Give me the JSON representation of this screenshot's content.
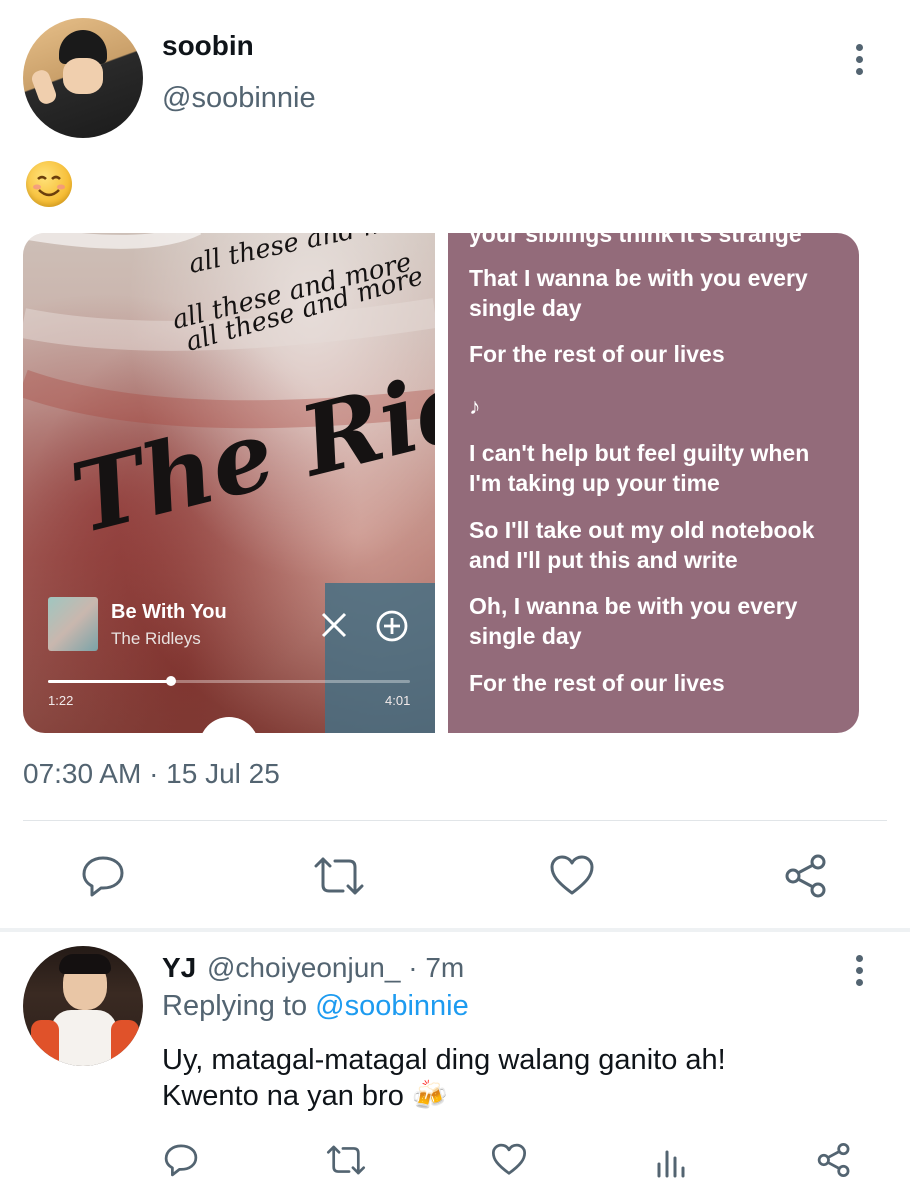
{
  "tweet": {
    "author_name": "soobin",
    "author_handle": "@soobinnie",
    "body_emoji": "😊",
    "timestamp": "07:30 AM · 15 Jul 25"
  },
  "music_card": {
    "album_text_lines": [
      "all these and more",
      "all these and more",
      "all these and more"
    ],
    "album_band": "The Ridleys",
    "song_title": "Be With You",
    "song_artist": "The Ridleys",
    "elapsed": "1:22",
    "duration": "4:01",
    "progress": 0.34
  },
  "lyrics": {
    "cut_line": "your siblings think it's strange",
    "lines": [
      "That I wanna be with you every single day",
      "For the rest of our lives",
      "♪",
      "I can't help but feel guilty when I'm taking up your time",
      "So I'll take out my old notebook and I'll put this and write",
      "Oh, I wanna be with you every single day",
      "For the rest of our lives"
    ]
  },
  "actions": [
    "reply-icon",
    "retweet-icon",
    "like-icon",
    "share-icon"
  ],
  "reply": {
    "name": "YJ",
    "handle_time": "@choiyeonjun_ · 7m",
    "replying_prefix": "Replying to ",
    "replying_handle": "@soobinnie",
    "text": "Uy, matagal-matagal ding walang ganito ah! Kwento na yan bro",
    "text_emoji": "🍻",
    "actions": [
      "reply-icon",
      "retweet-icon",
      "like-icon",
      "analytics-icon",
      "share-icon"
    ]
  },
  "colors": {
    "accent": "#1d9bf0",
    "muted": "#536471",
    "lyrics_bg": "#936b7a"
  }
}
